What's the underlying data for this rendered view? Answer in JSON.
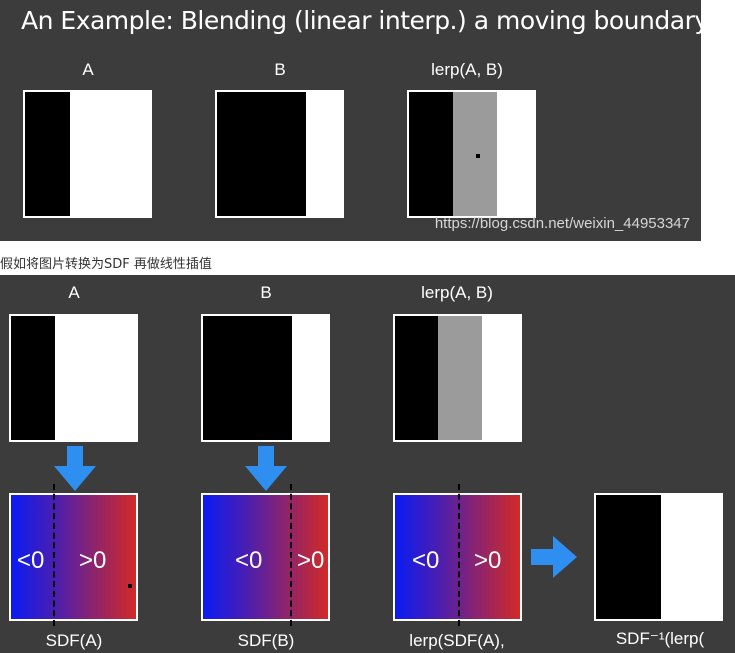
{
  "slide_top": {
    "title": "An Example: Blending (linear interp.) a moving boundary",
    "labels": [
      "A",
      "B",
      "lerp(A, B)"
    ],
    "watermark": "https://blog.csdn.net/weixin_44953347"
  },
  "caption": "假如将图片转换为SDF 再做线性插值",
  "slide_bottom": {
    "labels": [
      "A",
      "B",
      "lerp(A, B)"
    ],
    "sdf_labels": [
      "SDF(A)",
      "SDF(B)",
      "lerp(SDF(A),",
      "SDF⁻¹(lerp("
    ],
    "negative_sign": "<0",
    "positive_sign": ">0"
  },
  "colors": {
    "panel_background": "#3c3c3c",
    "arrow": "#2e8ff0",
    "lerp_gray": "#9b9b9b",
    "sdf_blue": "#0a1cf2",
    "sdf_red": "#d22a26"
  }
}
